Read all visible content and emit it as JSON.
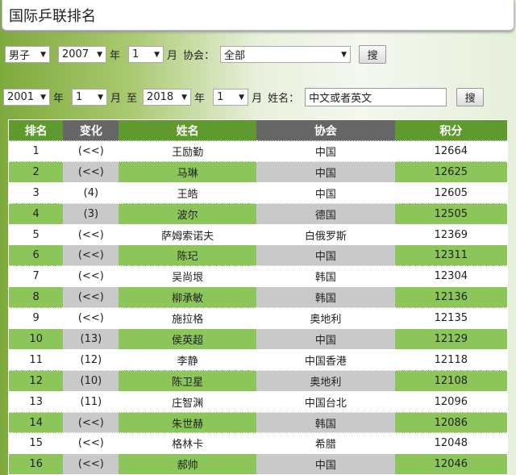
{
  "title": "国际乒联排名",
  "filters1": {
    "gender": "男子",
    "year": "2007",
    "year_label": "年",
    "month": "1",
    "month_label": "月",
    "assoc_label": "协会：",
    "assoc": "全部",
    "search": "搜"
  },
  "filters2": {
    "from_year": "2001",
    "year_label": "年",
    "from_month": "1",
    "month_label": "月",
    "to_label": "至",
    "to_year": "2018",
    "to_month": "1",
    "name_label": "姓名：",
    "name_placeholder": "中文或者英文",
    "search": "搜"
  },
  "table": {
    "headers": [
      "排名",
      "变化",
      "姓名",
      "协会",
      "积分"
    ],
    "rows": [
      [
        "1",
        "(<<)",
        "王励勤",
        "中国",
        "12664"
      ],
      [
        "2",
        "(<<)",
        "马琳",
        "中国",
        "12625"
      ],
      [
        "3",
        "(4)",
        "王皓",
        "中国",
        "12605"
      ],
      [
        "4",
        "(3)",
        "波尔",
        "德国",
        "12505"
      ],
      [
        "5",
        "(<<)",
        "萨姆索诺夫",
        "白俄罗斯",
        "12369"
      ],
      [
        "6",
        "(<<)",
        "陈玘",
        "中国",
        "12311"
      ],
      [
        "7",
        "(<<)",
        "吴尚垠",
        "韩国",
        "12304"
      ],
      [
        "8",
        "(<<)",
        "柳承敏",
        "韩国",
        "12136"
      ],
      [
        "9",
        "(<<)",
        "施拉格",
        "奥地利",
        "12135"
      ],
      [
        "10",
        "(13)",
        "侯英超",
        "中国",
        "12129"
      ],
      [
        "11",
        "(12)",
        "李静",
        "中国香港",
        "12118"
      ],
      [
        "12",
        "(10)",
        "陈卫星",
        "奥地利",
        "12108"
      ],
      [
        "13",
        "(11)",
        "庄智渊",
        "中国台北",
        "12096"
      ],
      [
        "14",
        "(<<)",
        "朱世赫",
        "韩国",
        "12086"
      ],
      [
        "15",
        "(<<)",
        "格林卡",
        "希腊",
        "12048"
      ],
      [
        "16",
        "(<<)",
        "郝帅",
        "中国",
        "12046"
      ]
    ]
  }
}
